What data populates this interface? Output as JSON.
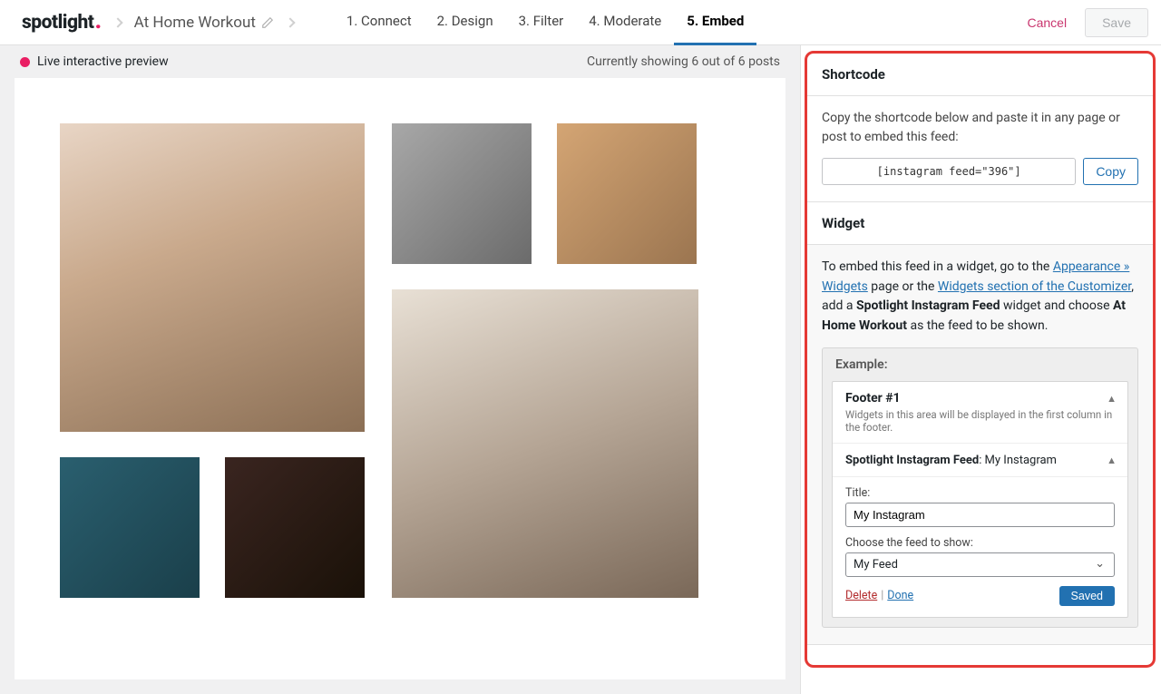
{
  "logo": {
    "text": "spotlight"
  },
  "feed_name": "At Home Workout",
  "steps": [
    {
      "label": "1. Connect"
    },
    {
      "label": "2. Design"
    },
    {
      "label": "3. Filter"
    },
    {
      "label": "4. Moderate"
    },
    {
      "label": "5. Embed",
      "active": true
    }
  ],
  "header": {
    "cancel": "Cancel",
    "save": "Save"
  },
  "preview": {
    "live_label": "Live interactive preview",
    "count_text": "Currently showing 6 out of 6 posts"
  },
  "sidebar": {
    "shortcode": {
      "title": "Shortcode",
      "desc": "Copy the shortcode below and paste it in any page or post to embed this feed:",
      "code": "[instagram feed=\"396\"]",
      "copy_label": "Copy"
    },
    "widget": {
      "title": "Widget",
      "text_before": "To embed this feed in a widget, go to the ",
      "link1": "Appearance » Widgets",
      "text_mid": " page or the ",
      "link2": "Widgets section of the Customizer",
      "text_after1": ", add a ",
      "bold1": "Spotlight Instagram Feed",
      "text_after2": " widget and choose ",
      "bold2": "At Home Workout",
      "text_after3": " as the feed to be shown."
    },
    "example": {
      "label": "Example:",
      "footer_title": "Footer #1",
      "footer_sub": "Widgets in this area will be displayed in the first column in the footer.",
      "feed_label_prefix": "Spotlight Instagram Feed",
      "feed_label_value": ": My Instagram",
      "title_label": "Title:",
      "title_value": "My Instagram",
      "choose_label": "Choose the feed to show:",
      "choose_value": "My Feed",
      "delete": "Delete",
      "done": "Done",
      "saved": "Saved"
    }
  }
}
